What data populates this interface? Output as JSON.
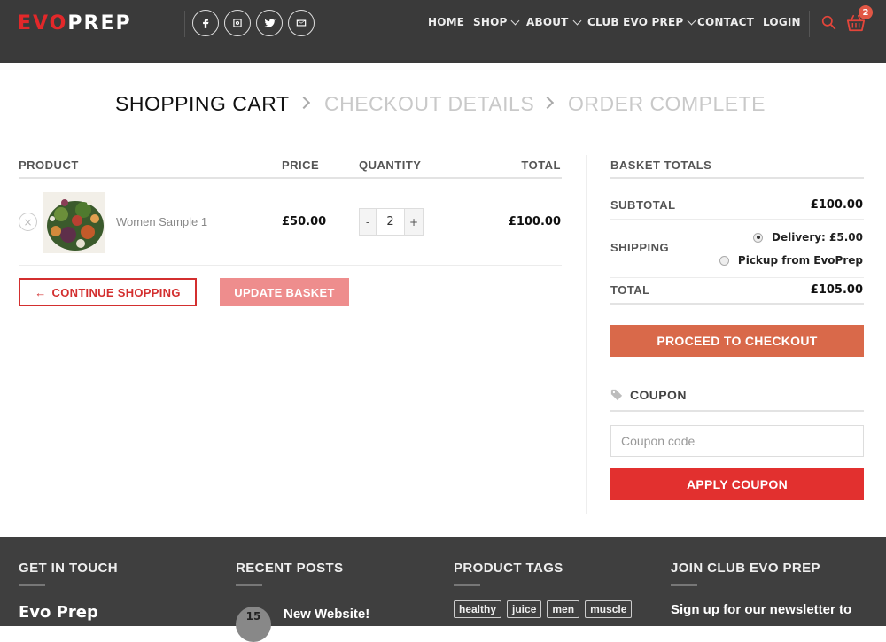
{
  "header": {
    "logo_part1": "EVO",
    "logo_part2": "PREP",
    "nav": [
      {
        "label": "HOME"
      },
      {
        "label": "SHOP"
      },
      {
        "label": "ABOUT"
      },
      {
        "label": "CLUB EVO PREP"
      },
      {
        "label": "CONTACT"
      },
      {
        "label": "LOGIN"
      }
    ],
    "cart_count": "2",
    "social": [
      "facebook-icon",
      "instagram-icon",
      "twitter-icon",
      "email-icon"
    ]
  },
  "steps": {
    "current": "SHOPPING CART",
    "next": "CHECKOUT DETAILS",
    "last": "ORDER COMPLETE"
  },
  "cart": {
    "headers": {
      "product": "PRODUCT",
      "price": "PRICE",
      "quantity": "QUANTITY",
      "total": "TOTAL"
    },
    "items": [
      {
        "name": "Women Sample 1",
        "price": "£50.00",
        "quantity": "2",
        "total": "£100.00"
      }
    ],
    "qty_minus": "-",
    "qty_plus": "+",
    "remove_symbol": "×",
    "continue_label": "CONTINUE SHOPPING",
    "continue_arrow": "←",
    "update_label": "UPDATE BASKET"
  },
  "totals": {
    "heading": "BASKET TOTALS",
    "subtotal_label": "SUBTOTAL",
    "subtotal_value": "£100.00",
    "shipping_label": "SHIPPING",
    "shipping_options": [
      {
        "label": "Delivery: £5.00",
        "selected": true
      },
      {
        "label": "Pickup from EvoPrep",
        "selected": false
      }
    ],
    "total_label": "TOTAL",
    "total_value": "£105.00",
    "checkout_label": "PROCEED TO CHECKOUT",
    "coupon_heading": "COUPON",
    "coupon_placeholder": "Coupon code",
    "apply_label": "APPLY COUPON"
  },
  "footer": {
    "get_in_touch": "GET IN TOUCH",
    "brand": "Evo Prep",
    "recent_posts": "RECENT POSTS",
    "post_day": "15",
    "post_title": "New Website!",
    "product_tags": "PRODUCT TAGS",
    "tags": [
      "healthy",
      "juice",
      "men",
      "muscle"
    ],
    "join_heading": "JOIN CLUB EVO PREP",
    "newsletter_text": "Sign up for our newsletter to"
  },
  "colors": {
    "header_bg": "#3a3a3a",
    "brand_red": "#e3282a",
    "checkout_orange": "#d9694a",
    "apply_red": "#e2302f",
    "update_pink": "#ee8d8d",
    "footer_bg": "#3f3f3f"
  }
}
